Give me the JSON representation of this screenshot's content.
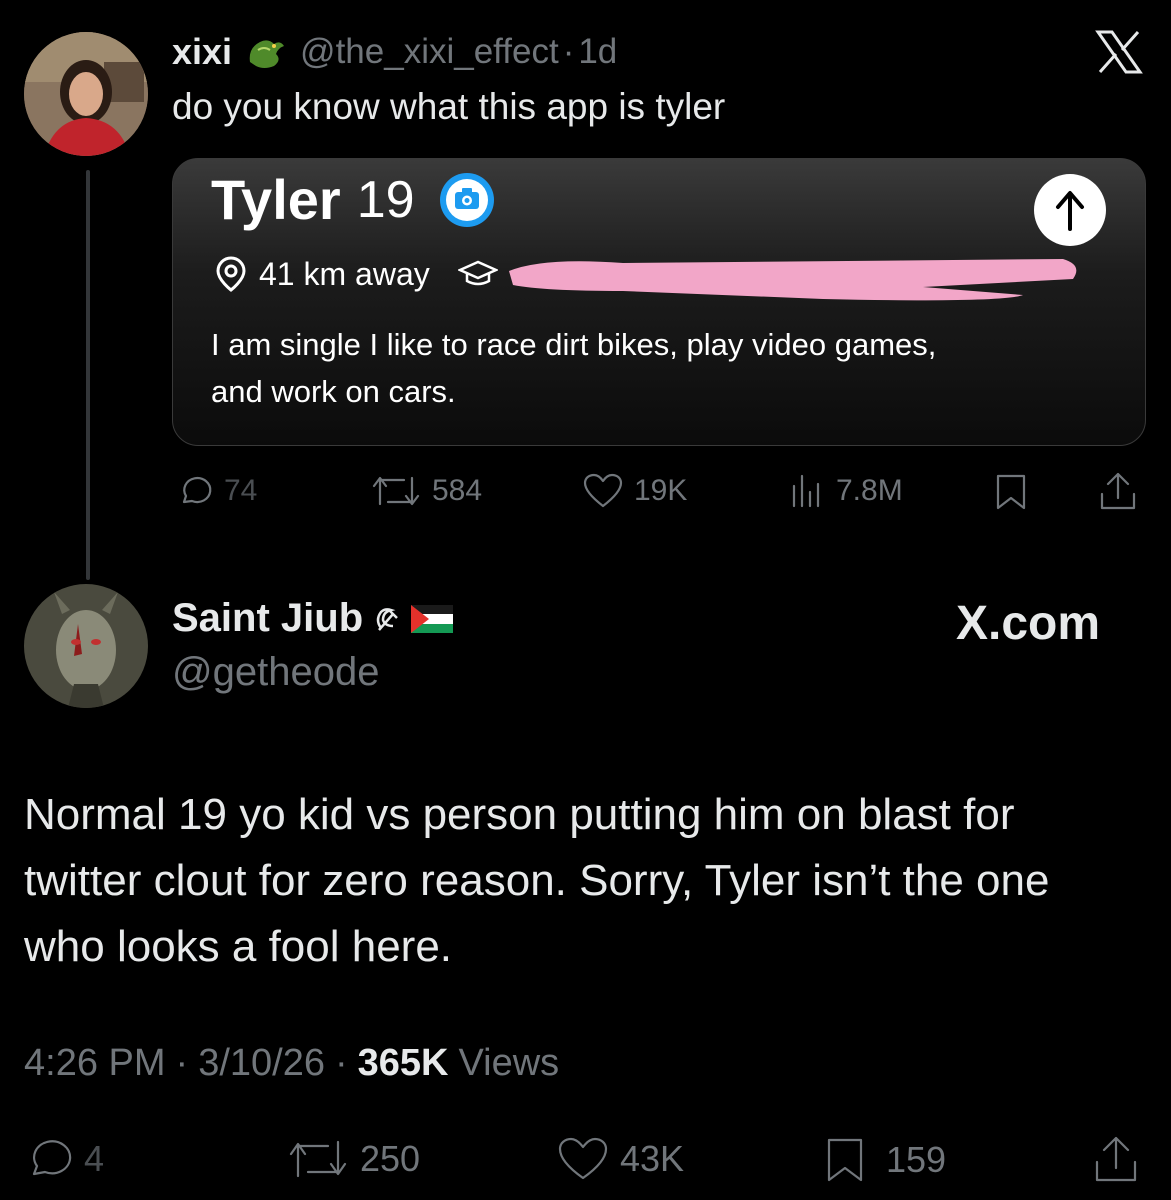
{
  "colors": {
    "background": "#000000",
    "text": "#e7e9ea",
    "muted": "#71767b",
    "verified": "#1d9bf0",
    "redaction": "#f2a6c8"
  },
  "original_tweet": {
    "author_name": "xixi",
    "author_emoji_icon": "dragon-icon",
    "handle": "@the_xixi_effect",
    "separator": "·",
    "time_ago": "1d",
    "text": "do you know what this app is tyler",
    "logo_icon": "x-logo-icon",
    "card": {
      "name": "Tyler",
      "age": "19",
      "verified_icon": "camera-badge-icon",
      "distance": "41 km away",
      "school_icon": "graduation-cap-icon",
      "bio_line1": "I am single I like to race dirt bikes, play video games,",
      "bio_line2": "and work on cars.",
      "share_icon": "arrow-up-icon"
    },
    "actions": {
      "replies": "74",
      "reposts": "584",
      "likes": "19K",
      "views": "7.8M"
    }
  },
  "reply_tweet": {
    "author_name": "Saint Jiub",
    "author_emojis": [
      "hammer-sickle-icon",
      "palestine-flag-icon"
    ],
    "handle": "@getheode",
    "brand": "X.com",
    "text": "Normal 19 yo kid vs person putting him on blast for twitter clout for zero reason. Sorry, Tyler isn’t the one who looks a fool here.",
    "time": "4:26 PM",
    "date": "3/10/26",
    "separator": "·",
    "views_count": "365K",
    "views_label": "Views",
    "actions": {
      "replies": "4",
      "reposts": "250",
      "likes": "43K",
      "bookmarks": "159"
    }
  }
}
